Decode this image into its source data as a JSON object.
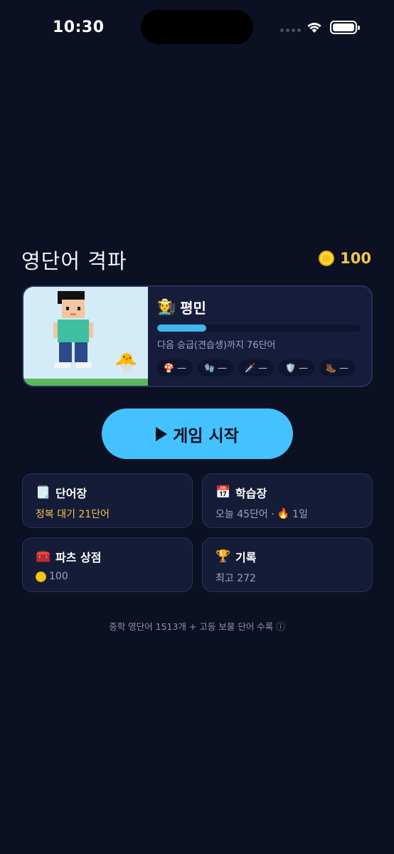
{
  "status": {
    "time": "10:30"
  },
  "header": {
    "title": "영단어 격파",
    "coins": "100"
  },
  "character": {
    "rank_icon": "🧑‍🌾",
    "rank_name": "평민",
    "progress_fraction": 0.24,
    "progress_label": "다음 승급(견습생)까지 76단어",
    "pet_icon": "🐣",
    "parts": [
      {
        "icon": "🍄",
        "value": "—"
      },
      {
        "icon": "🧤",
        "value": "—"
      },
      {
        "icon": "🗡️",
        "value": "—"
      },
      {
        "icon": "🛡️",
        "value": "—"
      },
      {
        "icon": "🥾",
        "value": "—"
      }
    ]
  },
  "start_button": {
    "label": "게임 시작"
  },
  "menu": {
    "wordbook": {
      "icon": "🗒️",
      "title": "단어장",
      "sub": "정복 대기 21단어"
    },
    "study": {
      "icon": "📅",
      "title": "학습장",
      "sub_words": "오늘 45단어 ·",
      "streak_icon": "🔥",
      "streak": "1일"
    },
    "shop": {
      "icon": "🧰",
      "title": "파츠 상점",
      "coins": "100"
    },
    "records": {
      "icon": "🏆",
      "title": "기록",
      "sub": "최고 272"
    }
  },
  "footer": {
    "note": "중학 영단어 1513개 + 고등 보물 단어 수록 ⓘ"
  }
}
